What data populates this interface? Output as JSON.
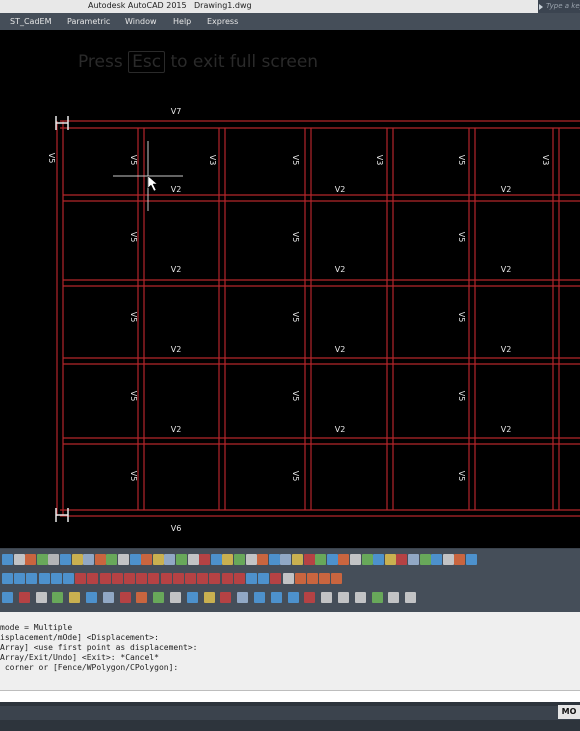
{
  "title_bar": {
    "app": "Autodesk AutoCAD 2015",
    "file": "Drawing1.dwg",
    "search_placeholder": "Type a keyword"
  },
  "menu": [
    "ST_CadEM",
    "Parametric",
    "Window",
    "Help",
    "Express"
  ],
  "fullscreen_hint": {
    "before": "Press",
    "key": "Esc",
    "after": "to exit full screen"
  },
  "drawing": {
    "line_color": "#b3262b",
    "label_color": "#e8e8e8",
    "top_beam": "V7",
    "bottom_beam": "V6",
    "left_beam": "V5",
    "interior_beam": "V2",
    "left_col_labels": [
      "V5",
      "V5",
      "V5",
      "V5",
      "V5"
    ],
    "mid_labels": [
      "V5",
      "V5",
      "V5",
      "V5",
      "V5"
    ],
    "right_labels": [
      "V5",
      "V5",
      "V5",
      "V5",
      "V5"
    ],
    "column_top_labels": [
      "V3",
      "V3",
      "V3"
    ]
  },
  "command_history": [
    "mode = Multiple",
    "isplacement/mOde] <Displacement>:",
    "Array] <use first point as displacement>:",
    "Array/Exit/Undo] <Exit>: *Cancel*",
    " corner or [Fence/WPolygon/CPolygon]:"
  ],
  "status": {
    "mode_button": "MO"
  }
}
